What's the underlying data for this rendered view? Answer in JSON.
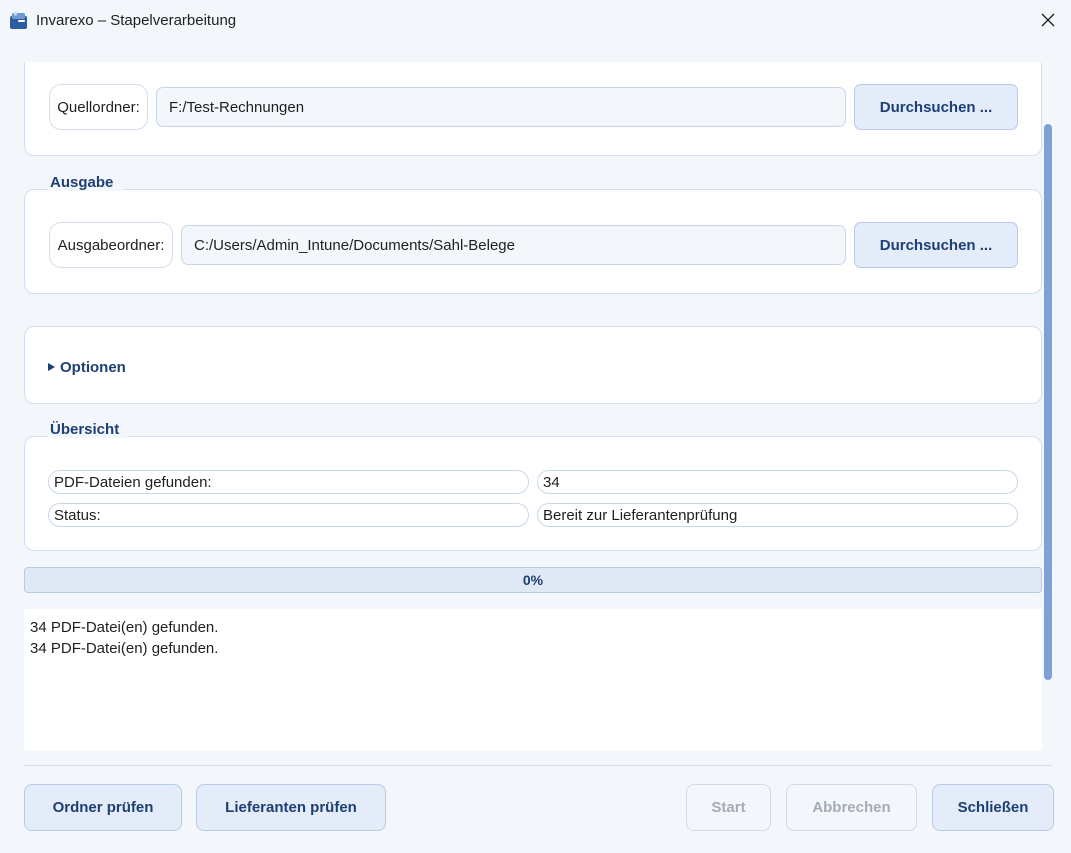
{
  "window": {
    "title": "Invarexo – Stapelverarbeitung",
    "icon": "invarexo-app-icon",
    "close_icon": "close-icon"
  },
  "source": {
    "label": "Quellordner:",
    "value": "F:/Test-Rechnungen",
    "browse_label": "Durchsuchen ..."
  },
  "output": {
    "section_title": "Ausgabe",
    "label": "Ausgabeordner:",
    "value": "C:/Users/Admin_Intune/Documents/Sahl-Belege",
    "browse_label": "Durchsuchen ..."
  },
  "options": {
    "label": "Optionen",
    "expanded": false,
    "icon": "triangle-right-icon"
  },
  "overview": {
    "section_title": "Übersicht",
    "rows": [
      {
        "label": "PDF-Dateien gefunden:",
        "value": "34"
      },
      {
        "label": "Status:",
        "value": "Bereit zur Lieferantenprüfung"
      }
    ]
  },
  "progress": {
    "value": 0,
    "text": "0%"
  },
  "log": {
    "lines": [
      "34 PDF-Datei(en) gefunden.",
      "34 PDF-Datei(en) gefunden."
    ]
  },
  "footer": {
    "check_folder": "Ordner prüfen",
    "check_suppliers": "Lieferanten prüfen",
    "start": "Start",
    "cancel": "Abbrechen",
    "close": "Schließen"
  },
  "colors": {
    "accent": "#1d3f73",
    "button_bg": "#e3ecf8",
    "window_bg": "#f3f6fb",
    "scroll_thumb": "#7ea2d3",
    "disabled_text": "#a3acb8"
  }
}
